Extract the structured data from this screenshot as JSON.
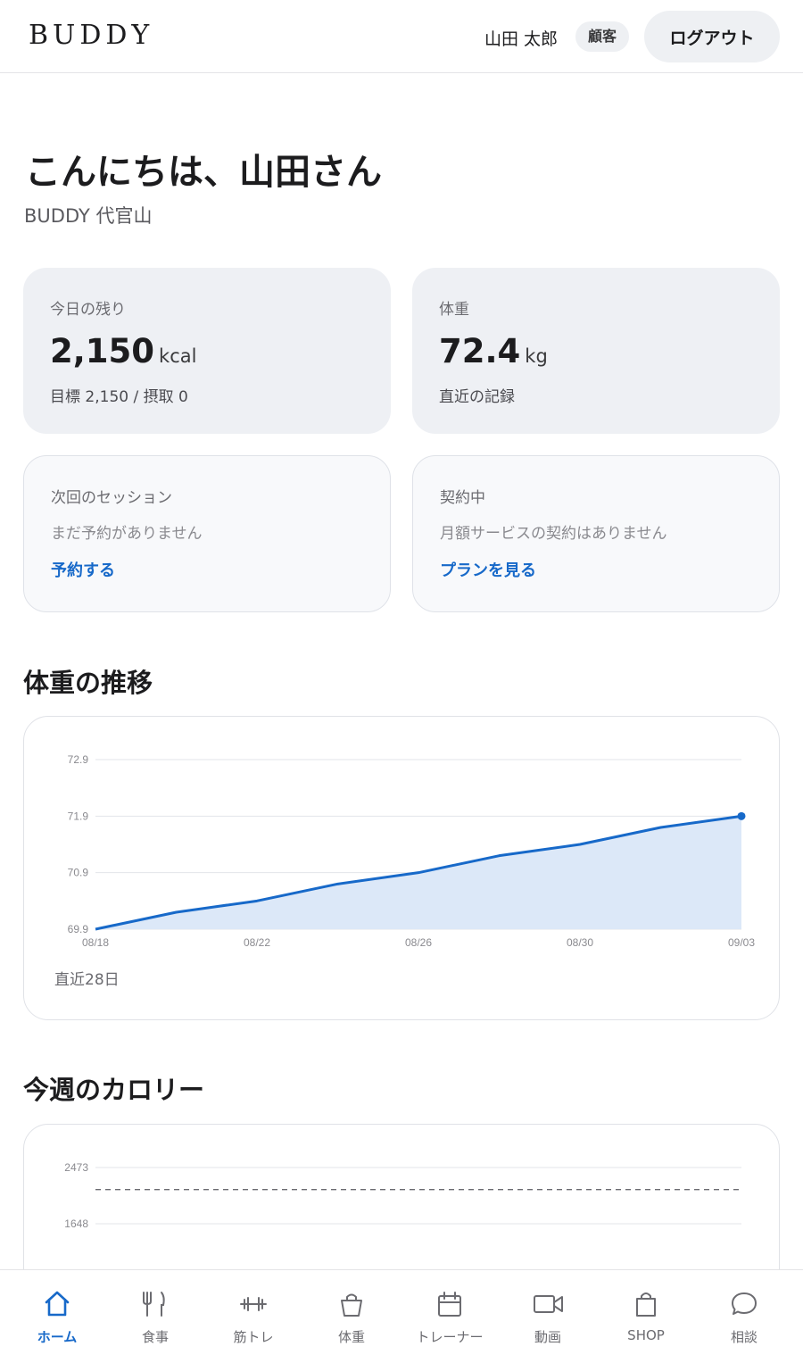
{
  "header": {
    "logo": "BUDDY",
    "user_name": "山田 太郎",
    "role_badge": "顧客",
    "logout_label": "ログアウト"
  },
  "greeting": "こんにちは、山田さん",
  "store": "BUDDY 代官山",
  "cards": {
    "calories": {
      "label": "今日の残り",
      "value": "2,150",
      "unit": "kcal",
      "sub": "目標 2,150 / 摂取 0"
    },
    "weight": {
      "label": "体重",
      "value": "72.4",
      "unit": "kg",
      "sub": "直近の記録"
    },
    "session": {
      "label": "次回のセッション",
      "text": "まだ予約がありません",
      "link": "予約する"
    },
    "contract": {
      "label": "契約中",
      "text": "月額サービスの契約はありません",
      "link": "プランを見る"
    }
  },
  "weight_section": {
    "title": "体重の推移",
    "footer": "直近28日"
  },
  "calorie_section": {
    "title": "今週のカロリー"
  },
  "colors": {
    "accent": "#1769c9",
    "area": "#dce8f8",
    "card_bg": "#eef0f4"
  },
  "chart_data": [
    {
      "type": "area",
      "x": [
        "08/18",
        "08/20",
        "08/22",
        "08/24",
        "08/26",
        "08/28",
        "08/30",
        "09/01",
        "09/03"
      ],
      "values": [
        69.9,
        70.2,
        70.4,
        70.7,
        70.9,
        71.2,
        71.4,
        71.7,
        71.9
      ],
      "x_ticks": [
        "08/18",
        "08/22",
        "08/26",
        "08/30",
        "09/03"
      ],
      "y_ticks": [
        "72.9",
        "71.9",
        "70.9",
        "69.9"
      ],
      "ylim": [
        69.9,
        72.9
      ],
      "grid": true
    },
    {
      "type": "bar",
      "y_ticks": [
        "2473",
        "1648"
      ],
      "target_line": 2150,
      "grid": true
    }
  ],
  "tabs": [
    {
      "label": "ホーム",
      "icon": "home-icon",
      "active": true
    },
    {
      "label": "食事",
      "icon": "utensils-icon",
      "active": false
    },
    {
      "label": "筋トレ",
      "icon": "dumbbell-icon",
      "active": false
    },
    {
      "label": "体重",
      "icon": "scale-icon",
      "active": false
    },
    {
      "label": "トレーナー",
      "icon": "calendar-icon",
      "active": false
    },
    {
      "label": "動画",
      "icon": "video-icon",
      "active": false
    },
    {
      "label": "SHOP",
      "icon": "shopping-bag-icon",
      "active": false
    },
    {
      "label": "相談",
      "icon": "chat-bubble-icon",
      "active": false
    }
  ]
}
